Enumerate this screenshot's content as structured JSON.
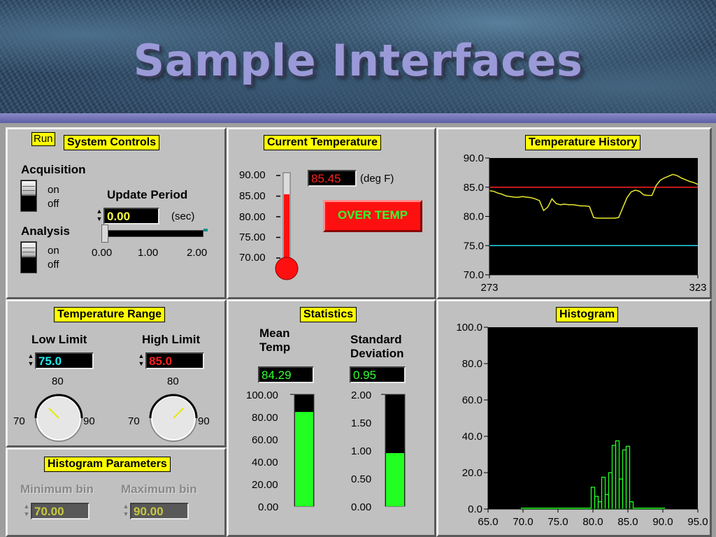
{
  "header": {
    "title": "Sample Interfaces"
  },
  "system_controls": {
    "title": "System Controls",
    "run_label": "Run",
    "acquisition_label": "Acquisition",
    "analysis_label": "Analysis",
    "on_label": "on",
    "off_label": "off",
    "update_period_label": "Update Period",
    "update_period_value": "0.00",
    "update_period_unit": "(sec)",
    "slider_ticks": [
      "0.00",
      "1.00",
      "2.00"
    ],
    "slider_min": 0,
    "slider_max": 2,
    "slider_value": 0
  },
  "current_temperature": {
    "title": "Current Temperature",
    "value": "85.45",
    "unit": "(deg F)",
    "alarm_label": "OVER TEMP",
    "scale_ticks": [
      "90.00",
      "85.00",
      "80.00",
      "75.00",
      "70.00"
    ],
    "scale_min": 70,
    "scale_max": 90,
    "level": 85.45
  },
  "temperature_history": {
    "title": "Temperature History"
  },
  "temperature_range": {
    "title": "Temperature Range",
    "low_label": "Low Limit",
    "high_label": "High Limit",
    "low_value": "75.0",
    "high_value": "85.0",
    "dial_min_label": "70",
    "dial_mid_label": "80",
    "dial_max_label": "90",
    "dial_min": 70,
    "dial_max": 90,
    "low_dial_value": 75,
    "high_dial_value": 85
  },
  "statistics": {
    "title": "Statistics",
    "mean_label_line1": "Mean",
    "mean_label_line2": "Temp",
    "stddev_label_line1": "Standard",
    "stddev_label_line2": "Deviation",
    "mean_value": "84.29",
    "stddev_value": "0.95",
    "mean_ticks": [
      "100.00",
      "80.00",
      "60.00",
      "40.00",
      "20.00",
      "0.00"
    ],
    "stddev_ticks": [
      "2.00",
      "1.50",
      "1.00",
      "0.50",
      "0.00"
    ],
    "mean_scale_max": 100,
    "stddev_scale_max": 2,
    "mean_level": 84.29,
    "stddev_level": 0.95
  },
  "histogram": {
    "title": "Histogram"
  },
  "histogram_parameters": {
    "title": "Histogram Parameters",
    "min_bin_label": "Minimum bin",
    "max_bin_label": "Maximum bin",
    "min_bin_value": "70.00",
    "max_bin_value": "90.00"
  },
  "colors": {
    "panel": "#c0c0c0",
    "label_bg": "#ffff00",
    "trace": "#e8e830",
    "high_limit": "#ff2020",
    "low_limit": "#20d8e8",
    "histogram_bar": "#22ff22",
    "mercury": "#ff1010"
  },
  "chart_data": [
    {
      "type": "line",
      "title": "Temperature History",
      "x": [
        273,
        274,
        275,
        276,
        277,
        278,
        279,
        280,
        281,
        282,
        283,
        284,
        285,
        286,
        287,
        288,
        289,
        290,
        291,
        292,
        293,
        294,
        295,
        296,
        297,
        298,
        299,
        300,
        301,
        302,
        303,
        304,
        305,
        306,
        307,
        308,
        309,
        310,
        311,
        312,
        313,
        314,
        315,
        316,
        317,
        318,
        319,
        320,
        321,
        322,
        323
      ],
      "series": [
        {
          "values": [
            84.4,
            84.3,
            84.0,
            83.8,
            83.5,
            83.4,
            83.3,
            83.3,
            83.4,
            83.3,
            83.2,
            83.0,
            82.7,
            81.0,
            81.6,
            83.0,
            82.2,
            82.0,
            82.1,
            82.0,
            82.0,
            81.9,
            81.8,
            81.8,
            81.7,
            79.8,
            79.7,
            79.7,
            79.7,
            79.7,
            79.7,
            79.8,
            81.5,
            83.2,
            84.2,
            84.5,
            84.3,
            83.7,
            83.6,
            83.6,
            85.3,
            86.2,
            86.6,
            86.9,
            87.2,
            87.0,
            86.6,
            86.3,
            86.0,
            85.8,
            85.5
          ]
        },
        {
          "values": [
            85.0,
            85.0
          ]
        },
        {
          "values": [
            75.0,
            75.0
          ]
        }
      ],
      "limit_x": [
        273,
        323
      ],
      "xlim": [
        273,
        323
      ],
      "ylim": [
        70,
        90
      ],
      "x_ticks": [
        273,
        323
      ],
      "y_ticks": [
        "90.0",
        "85.0",
        "80.0",
        "75.0",
        "70.0"
      ]
    },
    {
      "type": "bar",
      "title": "Histogram",
      "bin_width": 0.5,
      "bins": [
        70.0,
        70.5,
        71.0,
        71.5,
        72.0,
        72.5,
        73.0,
        73.5,
        74.0,
        74.5,
        75.0,
        75.5,
        76.0,
        76.5,
        77.0,
        77.5,
        78.0,
        78.5,
        79.0,
        79.5,
        80.0,
        80.5,
        81.0,
        81.5,
        82.0,
        82.5,
        83.0,
        83.5,
        84.0,
        84.5,
        85.0,
        85.5,
        86.0,
        86.5,
        87.0,
        87.5,
        88.0,
        88.5,
        89.0,
        89.5,
        90.0
      ],
      "values": [
        0.5,
        0.5,
        0.5,
        0.5,
        0.5,
        0.5,
        0.5,
        0.5,
        0.5,
        0.5,
        0.5,
        0.5,
        0.5,
        0.5,
        0.5,
        0.5,
        0.5,
        0.5,
        0.5,
        0.5,
        12.0,
        7.0,
        4.0,
        17.5,
        8.0,
        20.0,
        35.0,
        37.5,
        16.5,
        32.5,
        34.5,
        4.0,
        0.5,
        0.5,
        0.5,
        0.5,
        0.5,
        0.5,
        0.5,
        0.5,
        0.5
      ],
      "xlim": [
        65,
        95
      ],
      "ylim": [
        0,
        100
      ],
      "x_ticks": [
        "65.0",
        "70.0",
        "75.0",
        "80.0",
        "85.0",
        "90.0",
        "95.0"
      ],
      "y_ticks": [
        "100.0",
        "80.0",
        "60.0",
        "40.0",
        "20.0",
        "0.0"
      ]
    }
  ]
}
